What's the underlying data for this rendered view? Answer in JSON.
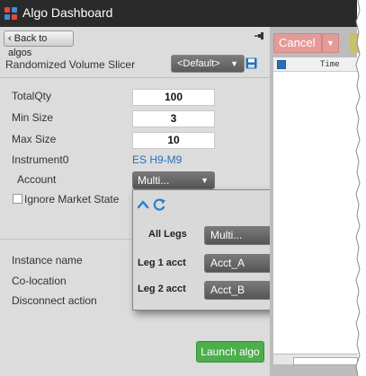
{
  "window": {
    "title": "Algo Dashboard",
    "icon": "app-grid-icon"
  },
  "toolbar": {
    "back_label": "Back to algos",
    "back_icon": "chevron-left-icon",
    "pin_icon": "pin-icon"
  },
  "algo": {
    "name": "Randomized Volume Slicer",
    "preset": "<Default>",
    "save_icon": "save-icon"
  },
  "params": {
    "total_qty_label": "TotalQty",
    "total_qty_value": "100",
    "min_size_label": "Min Size",
    "min_size_value": "3",
    "max_size_label": "Max Size",
    "max_size_value": "10",
    "instrument_label": "Instrument0",
    "instrument_value": "ES H9-M9",
    "account_label": "Account",
    "account_value": "Multi...",
    "ignore_market_state_label": "Ignore Market State",
    "ignore_market_state_checked": false
  },
  "instance": {
    "instance_name_label": "Instance name",
    "colocation_label": "Co-location",
    "disconnect_action_label": "Disconnect action"
  },
  "popup": {
    "collapse_icon": "chevron-up-icon",
    "refresh_icon": "refresh-icon",
    "all_legs_label": "All Legs",
    "all_legs_value": "Multi...",
    "leg1_label": "Leg 1 acct",
    "leg1_value": "Acct_A",
    "leg2_label": "Leg 2 acct",
    "leg2_value": "Acct_B"
  },
  "actions": {
    "launch_label": "Launch algo"
  },
  "orders": {
    "cancel_label": "Cancel",
    "time_header": "Time"
  },
  "colors": {
    "titlebar": "#2a2a2a",
    "launch": "#4cae4c",
    "cancel": "#e59a9a",
    "link": "#2a6fb5"
  }
}
